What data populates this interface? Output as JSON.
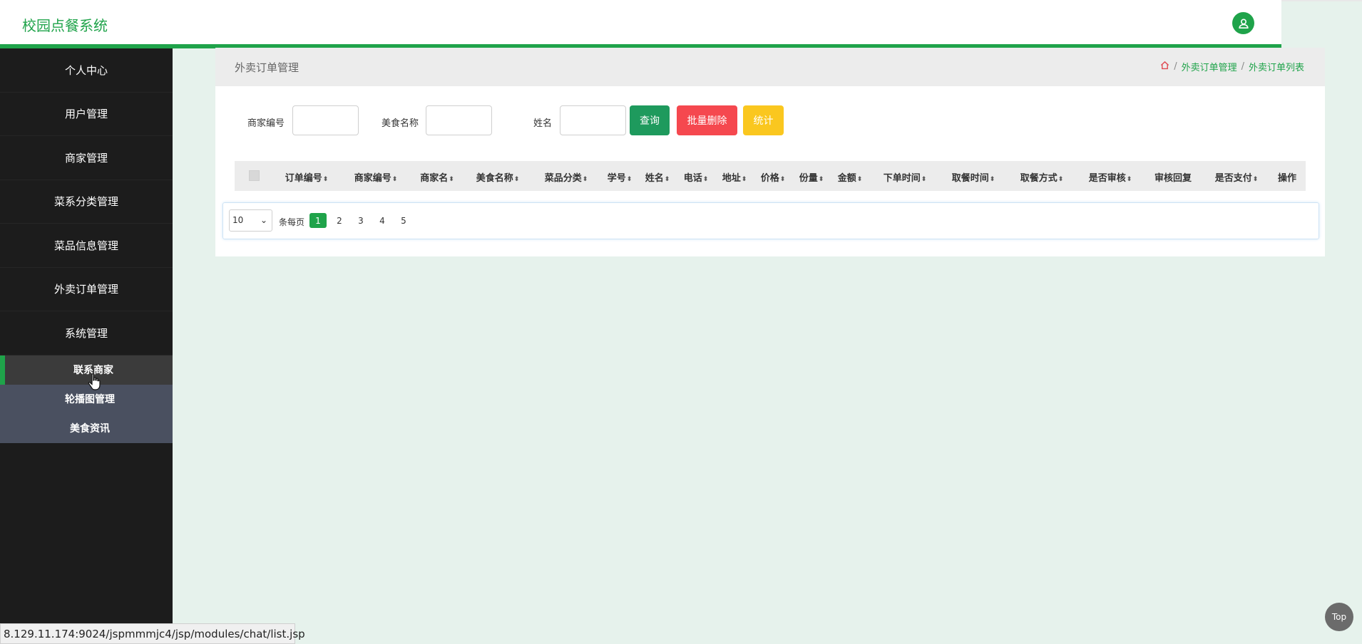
{
  "app": {
    "title": "校园点餐系统"
  },
  "sidebar": {
    "items": [
      {
        "label": "个人中心"
      },
      {
        "label": "用户管理"
      },
      {
        "label": "商家管理"
      },
      {
        "label": "菜系分类管理"
      },
      {
        "label": "菜品信息管理"
      },
      {
        "label": "外卖订单管理"
      },
      {
        "label": "系统管理"
      }
    ],
    "submenu": [
      {
        "label": "联系商家",
        "active": true
      },
      {
        "label": "轮播图管理"
      },
      {
        "label": "美食资讯"
      }
    ]
  },
  "breadcrumb": {
    "title": "外卖订单管理",
    "items": [
      "外卖订单管理",
      "外卖订单列表"
    ]
  },
  "search": {
    "merchant_no_label": "商家编号",
    "food_name_label": "美食名称",
    "name_label": "姓名",
    "query_button": "查询",
    "batch_delete_button": "批量删除",
    "stats_button": "统计"
  },
  "table": {
    "columns": [
      "订单编号",
      "商家编号",
      "商家名",
      "美食名称",
      "菜品分类",
      "学号",
      "姓名",
      "电话",
      "地址",
      "价格",
      "份量",
      "金额",
      "下单时间",
      "取餐时间",
      "取餐方式",
      "是否审核",
      "审核回复",
      "是否支付",
      "操作"
    ]
  },
  "pagination": {
    "page_size": "10",
    "per_page_label": "条每页",
    "pages": [
      "1",
      "2",
      "3",
      "4",
      "5"
    ],
    "current": "1"
  },
  "status_bar": {
    "url": "8.129.11.174:9024/jspmmmjc4/jsp/modules/chat/list.jsp"
  },
  "top_button": "Top",
  "colors": {
    "accent": "#1fa34a",
    "danger": "#f5484f",
    "warning": "#fac71f",
    "query": "#1e9a5d"
  }
}
